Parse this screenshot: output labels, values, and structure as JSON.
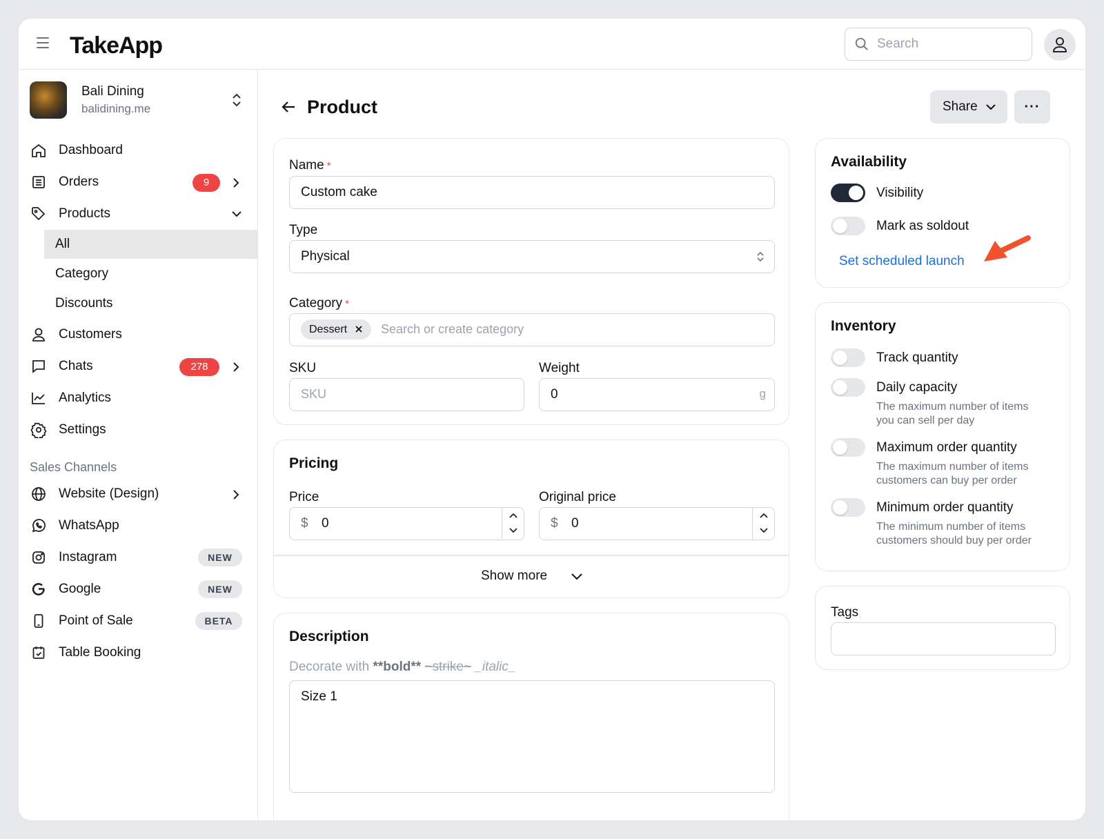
{
  "app": {
    "name": "TakeApp"
  },
  "search": {
    "placeholder": "Search"
  },
  "store": {
    "name": "Bali Dining",
    "url": "balidining.me"
  },
  "sidebar": {
    "items": [
      {
        "label": "Dashboard",
        "icon": "home-icon"
      },
      {
        "label": "Orders",
        "icon": "list-icon",
        "badge": "9"
      },
      {
        "label": "Products",
        "icon": "tag-icon"
      },
      {
        "label": "All"
      },
      {
        "label": "Category"
      },
      {
        "label": "Discounts"
      },
      {
        "label": "Customers",
        "icon": "user-icon"
      },
      {
        "label": "Chats",
        "icon": "chat-icon",
        "badge": "278"
      },
      {
        "label": "Analytics",
        "icon": "chart-icon"
      },
      {
        "label": "Settings",
        "icon": "gear-icon"
      }
    ],
    "section_label": "Sales Channels",
    "channels": [
      {
        "label": "Website (Design)",
        "icon": "globe-icon"
      },
      {
        "label": "WhatsApp",
        "icon": "whatsapp-icon"
      },
      {
        "label": "Instagram",
        "icon": "instagram-icon",
        "pill": "NEW"
      },
      {
        "label": "Google",
        "icon": "google-icon",
        "pill": "NEW"
      },
      {
        "label": "Point of Sale",
        "icon": "phone-icon",
        "pill": "BETA"
      },
      {
        "label": "Table Booking",
        "icon": "calendar-icon"
      }
    ]
  },
  "page": {
    "title": "Product",
    "share_label": "Share",
    "more_label": "···"
  },
  "product": {
    "name_label": "Name",
    "name_value": "Custom cake",
    "required_mark": "*",
    "type_label": "Type",
    "type_value": "Physical",
    "category_label": "Category",
    "category_chip": "Dessert",
    "category_placeholder": "Search or create category",
    "sku_label": "SKU",
    "sku_placeholder": "SKU",
    "weight_label": "Weight",
    "weight_value": "0",
    "weight_unit": "g"
  },
  "pricing": {
    "title": "Pricing",
    "price_label": "Price",
    "price_currency": "$",
    "price_value": "0",
    "original_label": "Original price",
    "original_currency": "$",
    "original_value": "0",
    "show_more": "Show more"
  },
  "description": {
    "title": "Description",
    "hint_prefix": "Decorate with ",
    "hint_bold": "**bold**",
    "hint_strike": "~strike~",
    "hint_italic": "_italic_",
    "value": "Size 1"
  },
  "availability": {
    "title": "Availability",
    "visibility_label": "Visibility",
    "visibility_on": true,
    "soldout_label": "Mark as soldout",
    "soldout_on": false,
    "scheduled_link": "Set scheduled launch"
  },
  "inventory": {
    "title": "Inventory",
    "track_label": "Track quantity",
    "daily_label": "Daily capacity",
    "daily_help": "The maximum number of items you can sell per day",
    "max_label": "Maximum order quantity",
    "max_help": "The maximum number of items customers can buy per order",
    "min_label": "Minimum order quantity",
    "min_help": "The minimum number of items customers should buy per order"
  },
  "tags": {
    "title": "Tags",
    "value": ""
  },
  "colors": {
    "accent_link": "#1d6fd8",
    "badge_red": "#ef4444",
    "annotation_arrow": "#f0522d",
    "toggle_on": "#1f2937"
  }
}
